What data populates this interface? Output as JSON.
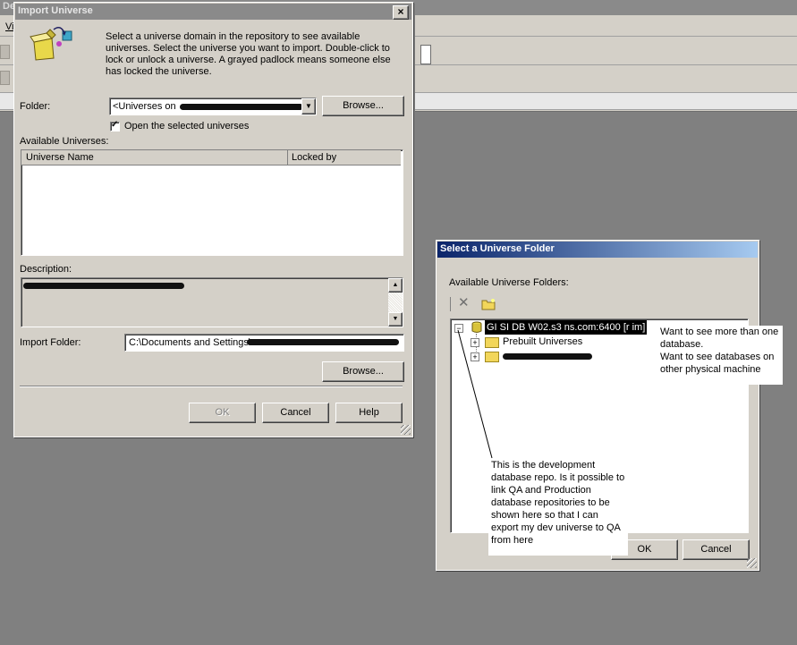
{
  "background_window": {
    "title": "De",
    "menu_first": "Vi"
  },
  "import_dialog": {
    "title": "Import Universe",
    "close_glyph": "×",
    "instructions": "Select a universe domain in the repository to see available universes. Select the universe you want to import. Double-click to lock or unlock a universe. A grayed padlock means someone else has locked the universe.",
    "folder_label": "Folder:",
    "folder_value": "<Universes on",
    "browse_label": "Browse...",
    "open_selected_label": "Open the selected universes",
    "open_selected_checked": true,
    "available_label": "Available Universes:",
    "columns": [
      "Universe Name",
      "Locked by"
    ],
    "description_label": "Description:",
    "import_folder_label": "Import Folder:",
    "import_folder_value": "C:\\Documents and Settings\\",
    "browse2_label": "Browse...",
    "ok_label": "OK",
    "cancel_label": "Cancel",
    "help_label": "Help"
  },
  "folder_dialog": {
    "title": "Select a Universe Folder",
    "available_label": "Available Universe Folders:",
    "tree": {
      "root": "GI SI DB W02.s3 ns.com:6400 [r im]",
      "children": [
        "Prebuilt Universes",
        ""
      ]
    },
    "ok_label": "OK",
    "cancel_label": "Cancel"
  },
  "annotations": {
    "note_top_right": [
      "Want to see more than one",
      "database.",
      "Want to see databases on",
      "other physical machine"
    ],
    "note_bottom": [
      "This is the development",
      "database repo. Is it possible to",
      "link QA and Production",
      "database repositories to be",
      "shown here so that I can",
      "export my dev universe to QA",
      "from here"
    ]
  }
}
